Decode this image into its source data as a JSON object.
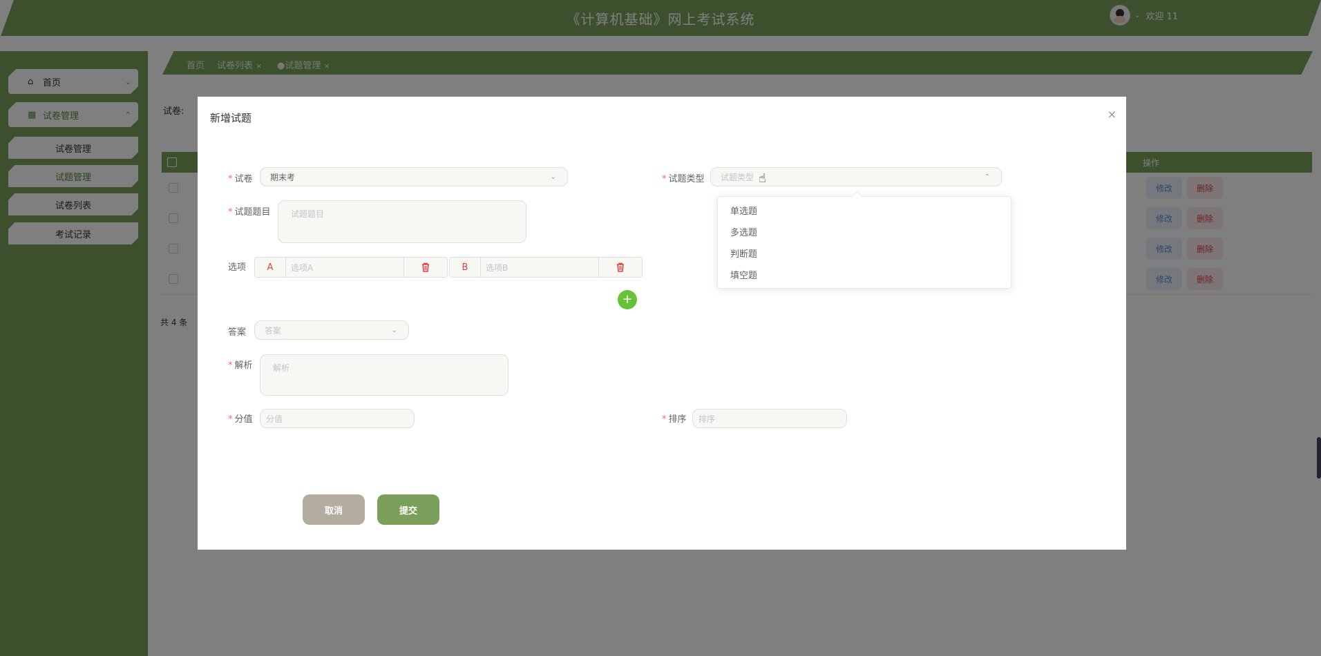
{
  "app": {
    "title": "《计算机基础》网上考试系统",
    "welcome": "欢迎 11"
  },
  "sidebar": {
    "items": [
      {
        "label": "首页"
      },
      {
        "label": "试卷管理"
      }
    ],
    "sub_items": [
      {
        "label": "试卷管理"
      },
      {
        "label": "试题管理"
      },
      {
        "label": "试卷列表"
      },
      {
        "label": "考试记录"
      }
    ]
  },
  "tabs": [
    {
      "label": "首页"
    },
    {
      "label": "试卷列表"
    },
    {
      "label": "●试题管理"
    }
  ],
  "filter": {
    "label": "试卷:"
  },
  "table": {
    "ops_header": "操作",
    "edit_label": "修改",
    "delete_label": "删除",
    "total": "共 4 条"
  },
  "dialog": {
    "title": "新增试题",
    "close": "×",
    "fields": {
      "paper": {
        "label": "试卷",
        "value": "期末考"
      },
      "type": {
        "label": "试题类型",
        "placeholder": "试题类型"
      },
      "question": {
        "label": "试题题目",
        "placeholder": "试题题目"
      },
      "options_label": "选项",
      "option_a": {
        "letter": "A",
        "placeholder": "选项A"
      },
      "option_b": {
        "letter": "B",
        "placeholder": "选项B"
      },
      "answer": {
        "label": "答案",
        "placeholder": "答案"
      },
      "analysis": {
        "label": "解析",
        "placeholder": "解析"
      },
      "score": {
        "label": "分值",
        "placeholder": "分值"
      },
      "order": {
        "label": "排序",
        "placeholder": "排序"
      }
    },
    "add_option": "+",
    "cancel_label": "取消",
    "submit_label": "提交"
  },
  "type_dropdown": {
    "options": [
      "单选题",
      "多选题",
      "判断题",
      "填空题"
    ]
  },
  "colors": {
    "brand_green": "#7aa05c",
    "required": "#f56c6c",
    "cancel": "#b5aca0",
    "add_button": "#67c23a"
  }
}
